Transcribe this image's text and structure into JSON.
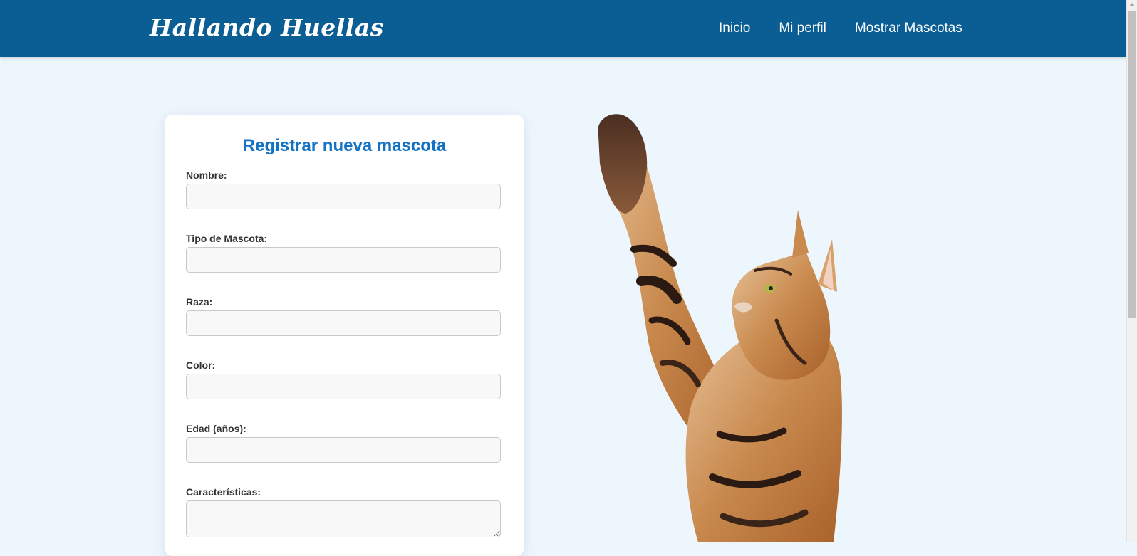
{
  "header": {
    "brand": "Hallando Huellas",
    "nav": [
      {
        "label": "Inicio"
      },
      {
        "label": "Mi perfil"
      },
      {
        "label": "Mostrar Mascotas"
      }
    ]
  },
  "form": {
    "title": "Registrar nueva mascota",
    "fields": [
      {
        "label": "Nombre:",
        "value": ""
      },
      {
        "label": "Tipo de Mascota:",
        "value": ""
      },
      {
        "label": "Raza:",
        "value": ""
      },
      {
        "label": "Color:",
        "value": ""
      },
      {
        "label": "Edad (años):",
        "value": ""
      },
      {
        "label": "Características:",
        "value": ""
      }
    ]
  },
  "colors": {
    "header_bg": "#0b5e94",
    "page_bg": "#eef6fd",
    "title": "#1273c4"
  },
  "hero_image": {
    "icon": "cat-reaching-up-image"
  }
}
